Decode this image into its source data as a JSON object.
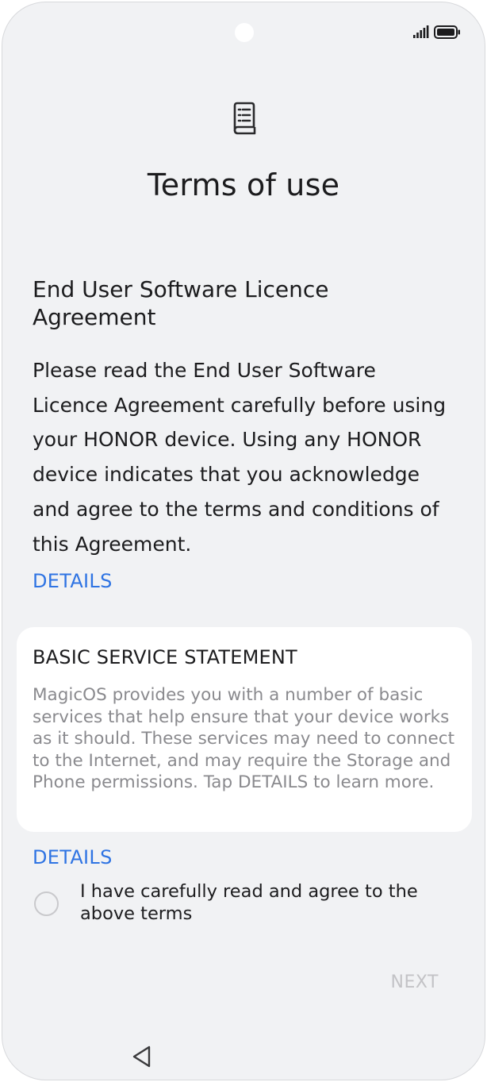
{
  "page": {
    "title": "Terms of use"
  },
  "eula": {
    "heading": "End User Software Licence Agreement",
    "body": "Please read the End User Software Licence Agreement carefully before using your HONOR device. Using any HONOR device indicates that you acknowledge and agree to the terms and conditions of this Agreement.",
    "details_label": "DETAILS"
  },
  "basic_service": {
    "title": "BASIC SERVICE STATEMENT",
    "body": "MagicOS provides you with a number of basic services that help ensure that your device works as it should. These services may need to connect to the Internet, and may require the Storage and Phone permissions. Tap DETAILS to learn more.",
    "details_label": "DETAILS"
  },
  "agreement": {
    "label": "I have carefully read and agree to the above terms",
    "checked": false
  },
  "footer": {
    "next_label": "NEXT"
  },
  "icons": {
    "header": "document-icon",
    "status_signal": "signal-icon",
    "status_battery": "battery-icon",
    "nav_back": "back-triangle-icon"
  },
  "colors": {
    "accent": "#2f74e3",
    "background": "#f1f2f4",
    "card": "#ffffff",
    "secondary_text": "#8a8a8e",
    "disabled": "#c3c3c6"
  }
}
